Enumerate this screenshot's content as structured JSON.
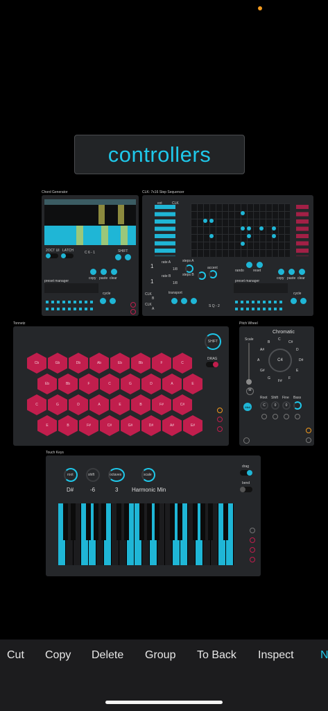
{
  "title": "controllers",
  "chord_generator": {
    "label": "Chord Generator",
    "latch_labels": [
      "2OCT UI",
      "LATCH"
    ],
    "chord_readout": "C 6 - 1",
    "shift": "SHIFT",
    "copy": "copy",
    "paste": "paste",
    "clear": "clear",
    "preset_manager": "preset manager",
    "cycle": "cycle"
  },
  "sequencer": {
    "label": "CLK: 7x16 Step Sequencer",
    "col_labels": [
      "ext",
      "CLK"
    ],
    "rate_a": "rate A",
    "rate_b": "rate B",
    "steps_a": "steps A",
    "steps_b": "steps B",
    "accent": "accent",
    "value_a": "1",
    "value_b": "1",
    "tempo_a": "1/8",
    "tempo_b": "1/8",
    "steps_a_val": "16",
    "steps_b_val": "16",
    "rando": "rando",
    "rnd_reset": "reset",
    "copy": "copy",
    "paste": "paste",
    "clear": "clear",
    "preset_manager": "preset manager",
    "cycle": "cycle",
    "clk_labels": [
      "CLK",
      "CLK"
    ],
    "clk_ab": [
      "B",
      "A"
    ],
    "transport": "transport",
    "seq_label": "S Q - 2"
  },
  "tonnetz": {
    "label": "Tonnetz",
    "shift": "SHIFT",
    "drag": "DRAG",
    "rows": [
      [
        "Cb",
        "Gb",
        "Db",
        "Ab",
        "Eb",
        "Bb",
        "F",
        "C"
      ],
      [
        "Eb",
        "Bb",
        "F",
        "C",
        "G",
        "D",
        "A",
        "E"
      ],
      [
        "C",
        "G",
        "D",
        "A",
        "E",
        "B",
        "F#",
        "C#"
      ],
      [
        "E",
        "B",
        "F#",
        "C#",
        "G#",
        "D#",
        "A#",
        "E#"
      ]
    ]
  },
  "pitch_wheel": {
    "label": "Pitch Wheel",
    "mode": "Chromatic",
    "scale": "Scale",
    "center": "C4",
    "notes": [
      "C",
      "C#",
      "D",
      "D#",
      "E",
      "F",
      "F#",
      "G",
      "G#",
      "A",
      "A#",
      "B"
    ],
    "controls": [
      "Root",
      "Shift",
      "Fine",
      "Bass"
    ],
    "ctrl_values": [
      "C",
      "0",
      "0",
      ""
    ],
    "midi": "Midi"
  },
  "touch_keys": {
    "label": "Touch Keys",
    "root_label": "root",
    "shift_label": "shift",
    "octaves_label": "octaves",
    "scale_label": "scale",
    "root_value": "D#",
    "shift_value": "-6",
    "octaves_value": "3",
    "scale_value": "Harmonic Min",
    "drag": "drag",
    "bend": "bend",
    "white_keys_on": [
      0,
      3,
      4,
      6,
      9,
      10,
      12,
      15,
      16,
      18,
      21,
      22
    ],
    "key_count": 23
  },
  "toolbar": {
    "items": [
      "Cut",
      "Copy",
      "Delete",
      "Group",
      "To Back",
      "Inspect"
    ],
    "more_label": "N"
  },
  "colors": {
    "accent": "#1fc8ea",
    "hex": "#c11e4d",
    "panel": "#25272a",
    "indicator": "#f39a1e"
  }
}
